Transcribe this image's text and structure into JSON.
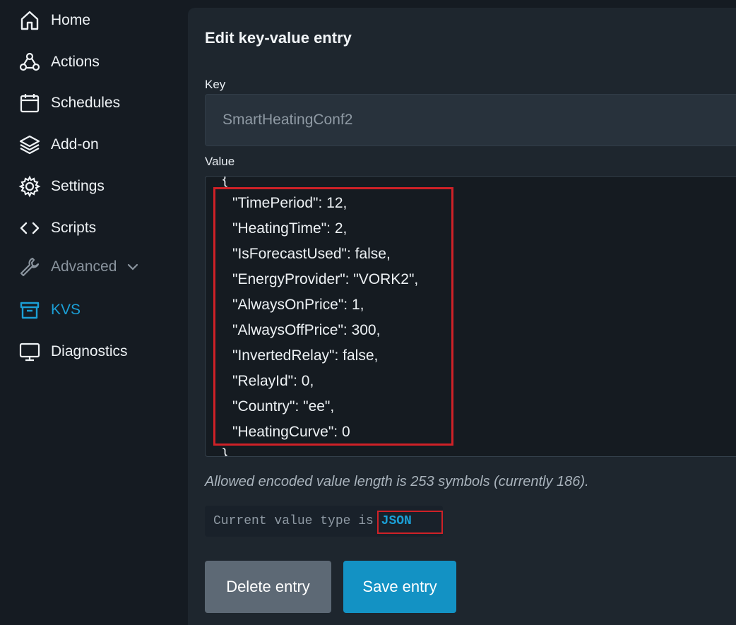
{
  "sidebar": {
    "items": [
      {
        "label": "Home",
        "icon": "home-icon"
      },
      {
        "label": "Actions",
        "icon": "webhook-icon"
      },
      {
        "label": "Schedules",
        "icon": "calendar-icon"
      },
      {
        "label": "Add-on",
        "icon": "layers-icon"
      },
      {
        "label": "Settings",
        "icon": "gear-icon"
      },
      {
        "label": "Scripts",
        "icon": "code-icon"
      },
      {
        "label": "Advanced",
        "icon": "wrench-icon"
      },
      {
        "label": "KVS",
        "icon": "archive-icon"
      },
      {
        "label": "Diagnostics",
        "icon": "monitor-icon"
      }
    ],
    "active_item": "KVS",
    "accent_color": "#1b9fd6"
  },
  "panel": {
    "title": "Edit key-value entry",
    "key_label": "Key",
    "key_value": "SmartHeatingConf2",
    "value_label": "Value",
    "value_open_brace": "{",
    "value_close_brace": "}",
    "value_lines": [
      "\"TimePeriod\": 12,",
      "\"HeatingTime\": 2,",
      "\"IsForecastUsed\": false,",
      "\"EnergyProvider\": \"VORK2\",",
      "\"AlwaysOnPrice\": 1,",
      "\"AlwaysOffPrice\": 300,",
      "\"InvertedRelay\": false,",
      "\"RelayId\": 0,",
      "\"Country\": \"ee\",",
      "\"HeatingCurve\": 0"
    ],
    "length_hint": "Allowed encoded value length is 253 symbols (currently 186).",
    "type_prefix": "Current value type is ",
    "type_value": "JSON",
    "delete_label": "Delete entry",
    "save_label": "Save entry",
    "highlight_color": "#cf2127"
  }
}
